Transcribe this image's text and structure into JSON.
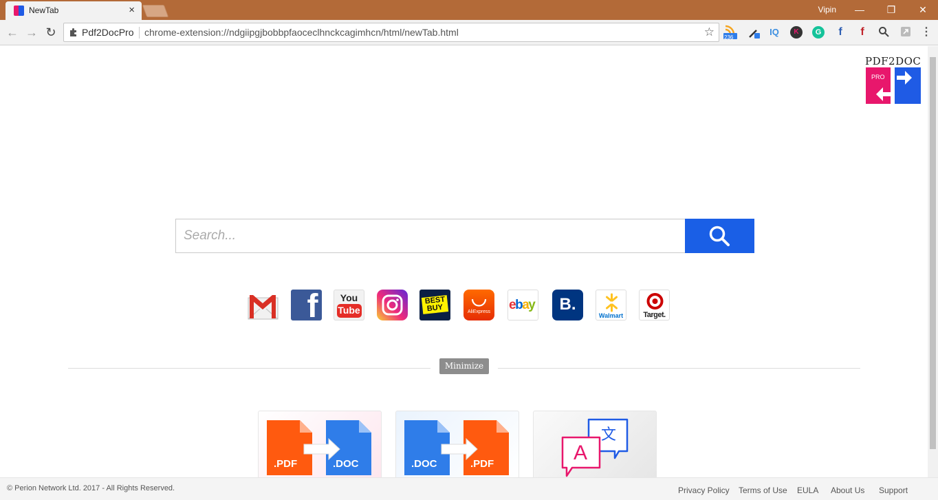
{
  "browser": {
    "tab_title": "NewTab",
    "tab_close": "×",
    "user_name": "Vipin",
    "window_minimize": "—",
    "window_restore": "❐",
    "window_close": "✕"
  },
  "toolbar": {
    "back_icon": "←",
    "forward_icon": "→",
    "reload_icon": "↻",
    "site_name": "Pdf2DocPro",
    "url": "chrome-extension://ndgiipgjbobbpfaoceclhnckcagimhcn/html/newTab.html",
    "bookmark_star": "☆",
    "extensions": {
      "rss_badge": "236",
      "iq_label": "IQ",
      "k_label": "K",
      "g_label": "G",
      "f1_label": "f",
      "f2_label": "f",
      "menu_icon": "⋮"
    }
  },
  "logo": {
    "text": "PDF2DOC",
    "pro": "PRO"
  },
  "search": {
    "placeholder": "Search..."
  },
  "shortcuts": {
    "gmail_icon": "gmail-icon",
    "facebook_letter": "f",
    "youtube_top": "You",
    "youtube_bottom": "Tube",
    "bestbuy_line1": "BEST",
    "bestbuy_line2": "BUY",
    "aliexpress": "AliExpress",
    "ebay_e": "e",
    "ebay_b": "b",
    "ebay_a": "a",
    "ebay_y": "y",
    "booking_letter": "B.",
    "walmart": "Walmart",
    "target": "Target."
  },
  "minimize_label": "Minimize",
  "cards": {
    "pdf_to_doc": {
      "from": ".PDF",
      "to": ".DOC"
    },
    "doc_to_pdf": {
      "from": ".DOC",
      "to": ".PDF"
    },
    "translate": {
      "latin": "A",
      "cjk": "文"
    }
  },
  "footer": {
    "copyright": "© Perion Network Ltd. 2017 - All Rights Reserved.",
    "links": [
      "Privacy Policy",
      "Terms of Use",
      "EULA",
      "About Us",
      "Support"
    ]
  },
  "colors": {
    "titlebar": "#b36a38",
    "brand_pink": "#e8176c",
    "brand_blue": "#1f5be5",
    "search_button": "#1a5fe6",
    "pdf_orange": "#ff5a0f",
    "doc_blue": "#2f7de9"
  }
}
